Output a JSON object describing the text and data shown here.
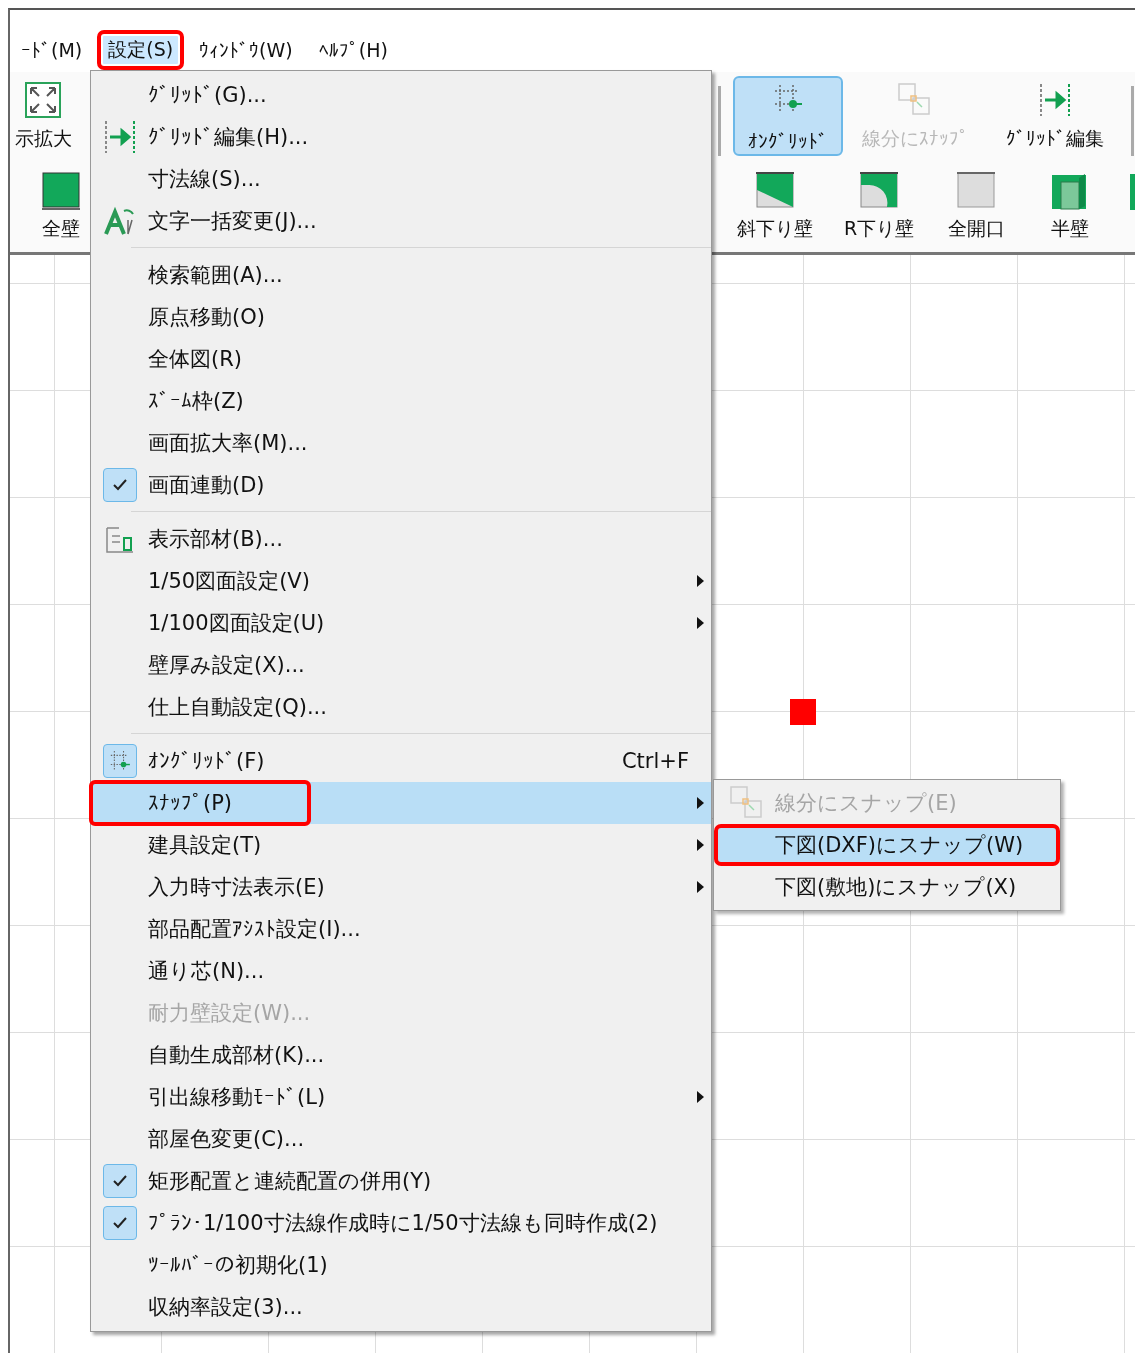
{
  "menu_bar": [
    {
      "label": "ｰﾄﾞ(M)",
      "selected": false,
      "annotated": false
    },
    {
      "label": "設定(S)",
      "selected": true,
      "annotated": true
    },
    {
      "label": "ｳｨﾝﾄﾞｳ(W)",
      "selected": false,
      "annotated": false
    },
    {
      "label": "ﾍﾙﾌﾟ(H)",
      "selected": false,
      "annotated": false
    }
  ],
  "toolbar_top": [
    {
      "label": "示拡大",
      "selected": false,
      "disabled": false
    },
    {
      "label": "ｵﾝｸﾞﾘｯﾄﾞ",
      "selected": true,
      "disabled": false
    },
    {
      "label": "線分にｽﾅｯﾌﾟ",
      "selected": false,
      "disabled": true
    },
    {
      "label": "ｸﾞﾘｯﾄﾞ編集",
      "selected": false,
      "disabled": false
    }
  ],
  "toolbar_bottom": [
    {
      "label": "全壁"
    },
    {
      "label": "斜下り壁"
    },
    {
      "label": "R下り壁"
    },
    {
      "label": "全開口"
    },
    {
      "label": "半壁"
    }
  ],
  "menu": [
    {
      "kind": "item",
      "label": "ｸﾞﾘｯﾄﾞ(G)...",
      "checked": false,
      "disabled": false,
      "selected": false,
      "submenu": false,
      "annotated": false
    },
    {
      "kind": "item",
      "label": "ｸﾞﾘｯﾄﾞ編集(H)...",
      "checked": false,
      "disabled": false,
      "selected": false,
      "submenu": false,
      "annotated": false
    },
    {
      "kind": "item",
      "label": "寸法線(S)...",
      "checked": false,
      "disabled": false,
      "selected": false,
      "submenu": false,
      "annotated": false
    },
    {
      "kind": "item",
      "label": "文字一括変更(J)...",
      "checked": false,
      "disabled": false,
      "selected": false,
      "submenu": false,
      "annotated": false
    },
    {
      "kind": "separator"
    },
    {
      "kind": "item",
      "label": "検索範囲(A)...",
      "checked": false,
      "disabled": false,
      "selected": false,
      "submenu": false,
      "annotated": false
    },
    {
      "kind": "item",
      "label": "原点移動(O)",
      "checked": false,
      "disabled": false,
      "selected": false,
      "submenu": false,
      "annotated": false
    },
    {
      "kind": "item",
      "label": "全体図(R)",
      "checked": false,
      "disabled": false,
      "selected": false,
      "submenu": false,
      "annotated": false
    },
    {
      "kind": "item",
      "label": "ｽﾞｰﾑ枠(Z)",
      "checked": false,
      "disabled": false,
      "selected": false,
      "submenu": false,
      "annotated": false
    },
    {
      "kind": "item",
      "label": "画面拡大率(M)...",
      "checked": false,
      "disabled": false,
      "selected": false,
      "submenu": false,
      "annotated": false
    },
    {
      "kind": "item",
      "label": "画面連動(D)",
      "checked": true,
      "disabled": false,
      "selected": false,
      "submenu": false,
      "annotated": false
    },
    {
      "kind": "separator"
    },
    {
      "kind": "item",
      "label": "表示部材(B)...",
      "checked": false,
      "disabled": false,
      "selected": false,
      "submenu": false,
      "annotated": false
    },
    {
      "kind": "item",
      "label": "1/50図面設定(V)",
      "checked": false,
      "disabled": false,
      "selected": false,
      "submenu": true,
      "annotated": false
    },
    {
      "kind": "item",
      "label": "1/100図面設定(U)",
      "checked": false,
      "disabled": false,
      "selected": false,
      "submenu": true,
      "annotated": false
    },
    {
      "kind": "item",
      "label": "壁厚み設定(X)...",
      "checked": false,
      "disabled": false,
      "selected": false,
      "submenu": false,
      "annotated": false
    },
    {
      "kind": "item",
      "label": "仕上自動設定(Q)...",
      "checked": false,
      "disabled": false,
      "selected": false,
      "submenu": false,
      "annotated": false
    },
    {
      "kind": "separator"
    },
    {
      "kind": "item",
      "label": "ｵﾝｸﾞﾘｯﾄﾞ(F)",
      "shortcut": "Ctrl+F",
      "checked": true,
      "disabled": false,
      "selected": false,
      "submenu": false,
      "annotated": false
    },
    {
      "kind": "item",
      "label": "ｽﾅｯﾌﾟ(P)",
      "checked": false,
      "disabled": false,
      "selected": true,
      "submenu": true,
      "annotated": true
    },
    {
      "kind": "item",
      "label": "建具設定(T)",
      "checked": false,
      "disabled": false,
      "selected": false,
      "submenu": true,
      "annotated": false
    },
    {
      "kind": "item",
      "label": "入力時寸法表示(E)",
      "checked": false,
      "disabled": false,
      "selected": false,
      "submenu": true,
      "annotated": false
    },
    {
      "kind": "item",
      "label": "部品配置ｱｼｽﾄ設定(I)...",
      "checked": false,
      "disabled": false,
      "selected": false,
      "submenu": false,
      "annotated": false
    },
    {
      "kind": "item",
      "label": "通り芯(N)...",
      "checked": false,
      "disabled": false,
      "selected": false,
      "submenu": false,
      "annotated": false
    },
    {
      "kind": "item",
      "label": "耐力壁設定(W)...",
      "checked": false,
      "disabled": true,
      "selected": false,
      "submenu": false,
      "annotated": false
    },
    {
      "kind": "item",
      "label": "自動生成部材(K)...",
      "checked": false,
      "disabled": false,
      "selected": false,
      "submenu": false,
      "annotated": false
    },
    {
      "kind": "item",
      "label": "引出線移動ﾓｰﾄﾞ(L)",
      "checked": false,
      "disabled": false,
      "selected": false,
      "submenu": true,
      "annotated": false
    },
    {
      "kind": "item",
      "label": "部屋色変更(C)...",
      "checked": false,
      "disabled": false,
      "selected": false,
      "submenu": false,
      "annotated": false
    },
    {
      "kind": "item",
      "label": "矩形配置と連続配置の併用(Y)",
      "checked": true,
      "disabled": false,
      "selected": false,
      "submenu": false,
      "annotated": false
    },
    {
      "kind": "item",
      "label": "ﾌﾟﾗﾝ･1/100寸法線作成時に1/50寸法線も同時作成(2)",
      "checked": true,
      "disabled": false,
      "selected": false,
      "submenu": false,
      "annotated": false
    },
    {
      "kind": "item",
      "label": "ﾂｰﾙﾊﾞｰの初期化(1)",
      "checked": false,
      "disabled": false,
      "selected": false,
      "submenu": false,
      "annotated": false
    },
    {
      "kind": "item",
      "label": "収納率設定(3)...",
      "checked": false,
      "disabled": false,
      "selected": false,
      "submenu": false,
      "annotated": false
    }
  ],
  "submenu": [
    {
      "label": "線分にスナップ(E)",
      "disabled": true,
      "selected": false,
      "annotated": false
    },
    {
      "label": "下図(DXF)にスナップ(W)",
      "disabled": false,
      "selected": true,
      "annotated": true
    },
    {
      "label": "下図(敷地)にスナップ(X)",
      "disabled": false,
      "selected": false,
      "annotated": false
    }
  ]
}
